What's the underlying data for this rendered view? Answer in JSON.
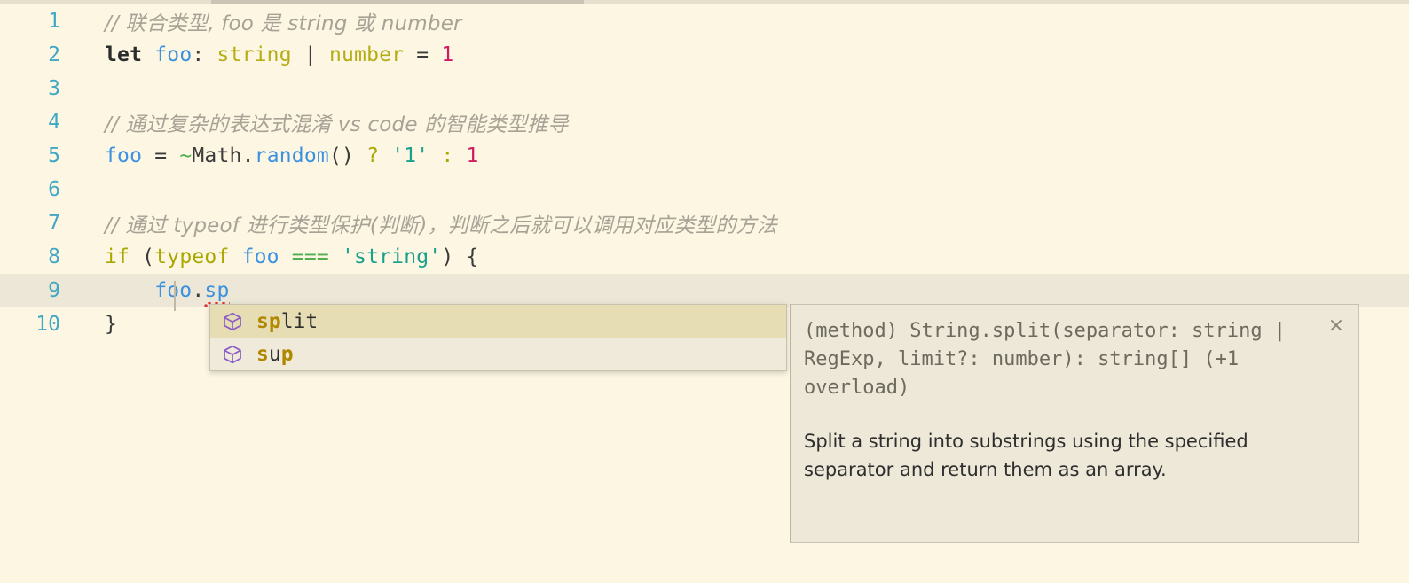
{
  "editor": {
    "background_color": "#FDF6E3",
    "active_line_color": "#ECE7D7",
    "gutter_color": "#3FA8C4",
    "lines": [
      {
        "number": "1",
        "active": false
      },
      {
        "number": "2",
        "active": false
      },
      {
        "number": "3",
        "active": false
      },
      {
        "number": "4",
        "active": false
      },
      {
        "number": "5",
        "active": false
      },
      {
        "number": "6",
        "active": false
      },
      {
        "number": "7",
        "active": false
      },
      {
        "number": "8",
        "active": false
      },
      {
        "number": "9",
        "active": true
      },
      {
        "number": "10",
        "active": false
      }
    ],
    "code": {
      "line1_comment": "// 联合类型, foo 是 string 或 number",
      "line2": {
        "keyword": "let",
        "variable": "foo",
        "colon": ": ",
        "type_string": "string",
        "union": " | ",
        "type_number": "number",
        "assign": " = ",
        "value": "1"
      },
      "line4_comment": "// 通过复杂的表达式混淆 vs code 的智能类型推导",
      "line5": {
        "variable": "foo",
        "assign": " = ",
        "tilde": "~",
        "object": "Math",
        "dot": ".",
        "method": "random",
        "parens": "()",
        "question": " ? ",
        "string_value": "'1'",
        "colon": " : ",
        "number_value": "1"
      },
      "line7_comment": "// 通过 typeof 进行类型保护(判断)，判断之后就可以调用对应类型的方法",
      "line8": {
        "keyword_if": "if",
        "open_paren": " (",
        "keyword_typeof": "typeof",
        "variable": " foo",
        "equality": " === ",
        "string_value": "'string'",
        "close": ") {"
      },
      "line9": {
        "variable": "foo",
        "dot": ".",
        "typed": "sp"
      },
      "line10": "}"
    }
  },
  "autocomplete": {
    "items": [
      {
        "icon": "method-cube-icon",
        "matched": "sp",
        "rest": "lit",
        "selected": true
      },
      {
        "icon": "method-cube-icon",
        "matched_1": "s",
        "rest_1": "u",
        "matched_2": "p",
        "selected": false
      }
    ],
    "selected_background": "#E6DDB4",
    "match_color": "#B08800",
    "icon_color": "#8B5CC7"
  },
  "doc_panel": {
    "signature": "(method) String.split(separator: string | RegExp, limit?: number): string[] (+1 overload)",
    "description": "Split a string into substrings using the specified separator and return them as an array.",
    "close_label": "×",
    "background_color": "#EDE8D8"
  }
}
